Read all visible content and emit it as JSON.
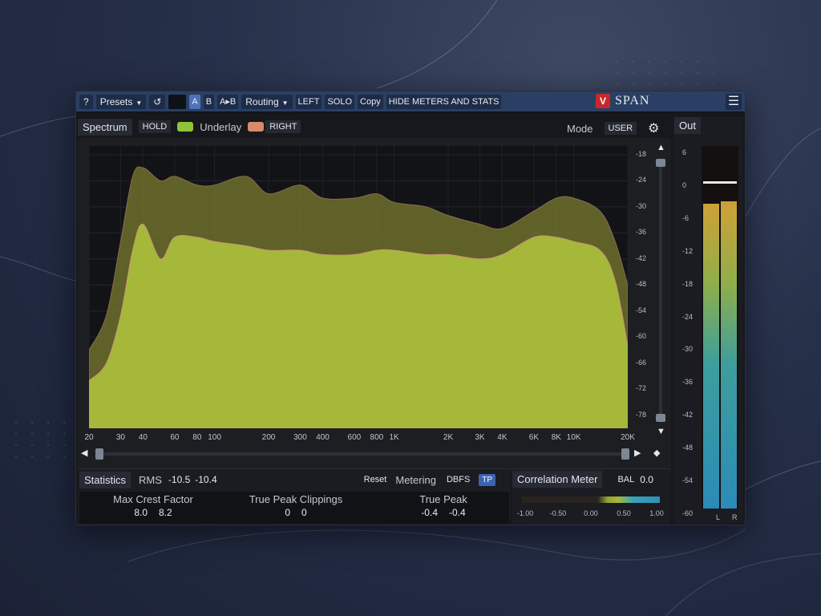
{
  "toolbar": {
    "help": "?",
    "presets": "Presets",
    "undo": "↺",
    "a": "A",
    "b": "B",
    "a_to_b": "A▸B",
    "routing": "Routing",
    "left": "LEFT",
    "solo": "SOLO",
    "copy": "Copy",
    "hide_meters": "HIDE METERS AND STATS",
    "logo_badge": "V",
    "logo_text": "SPAN",
    "menu": "☰"
  },
  "spectrum": {
    "tab": "Spectrum",
    "hold": "HOLD",
    "underlay": "Underlay",
    "right": "RIGHT",
    "mode_label": "Mode",
    "mode_value": "USER",
    "gear": "⚙",
    "hold_color": "#8dc43a",
    "right_color": "#d98a6a",
    "fill_color": "#a6b83a",
    "underlay_color": "#7c7b2e",
    "db_ticks": [
      "-18",
      "-24",
      "-30",
      "-36",
      "-42",
      "-48",
      "-54",
      "-60",
      "-66",
      "-72",
      "-78"
    ],
    "freq_ticks": [
      {
        "label": "20",
        "hz": 20
      },
      {
        "label": "30",
        "hz": 30
      },
      {
        "label": "40",
        "hz": 40
      },
      {
        "label": "60",
        "hz": 60
      },
      {
        "label": "80",
        "hz": 80
      },
      {
        "label": "100",
        "hz": 100
      },
      {
        "label": "200",
        "hz": 200
      },
      {
        "label": "300",
        "hz": 300
      },
      {
        "label": "400",
        "hz": 400
      },
      {
        "label": "600",
        "hz": 600
      },
      {
        "label": "800",
        "hz": 800
      },
      {
        "label": "1K",
        "hz": 1000
      },
      {
        "label": "2K",
        "hz": 2000
      },
      {
        "label": "3K",
        "hz": 3000
      },
      {
        "label": "4K",
        "hz": 4000
      },
      {
        "label": "6K",
        "hz": 6000
      },
      {
        "label": "8K",
        "hz": 8000
      },
      {
        "label": "10K",
        "hz": 10000
      },
      {
        "label": "20K",
        "hz": 20000
      }
    ]
  },
  "chart_data": {
    "type": "area",
    "xlabel": "",
    "ylabel": "",
    "xscale": "log",
    "ylim": [
      -81,
      -16
    ],
    "series": [
      {
        "name": "Underlay",
        "x": [
          20,
          25,
          30,
          35,
          40,
          50,
          60,
          80,
          100,
          150,
          200,
          300,
          400,
          600,
          800,
          1000,
          1500,
          2000,
          3000,
          4000,
          6000,
          8000,
          10000,
          14000,
          17000,
          20000
        ],
        "values": [
          -63,
          -55,
          -38,
          -23,
          -21,
          -24,
          -23,
          -25,
          -25,
          -23,
          -27,
          -25,
          -28,
          -28,
          -27,
          -29,
          -30,
          -32,
          -34,
          -35,
          -31,
          -28,
          -28,
          -31,
          -38,
          -48
        ]
      },
      {
        "name": "HOLD",
        "x": [
          20,
          25,
          30,
          35,
          40,
          50,
          60,
          80,
          100,
          150,
          200,
          300,
          400,
          600,
          800,
          1000,
          1500,
          2000,
          3000,
          4000,
          6000,
          8000,
          10000,
          14000,
          17000,
          20000
        ],
        "values": [
          -70,
          -66,
          -55,
          -40,
          -34,
          -42,
          -37,
          -37,
          -38,
          -39,
          -40,
          -40,
          -41,
          -41,
          -40,
          -40,
          -41,
          -41,
          -42,
          -41,
          -37,
          -37,
          -38,
          -40,
          -47,
          -62
        ]
      }
    ]
  },
  "statistics": {
    "tab": "Statistics",
    "rms_label": "RMS",
    "rms_l": "-10.5",
    "rms_r": "-10.4",
    "reset": "Reset",
    "metering": "Metering",
    "dbfs": "DBFS",
    "tp": "TP",
    "crest_title": "Max Crest Factor",
    "crest_l": "8.0",
    "crest_r": "8.2",
    "clip_title": "True Peak Clippings",
    "clip_l": "0",
    "clip_r": "0",
    "peak_title": "True Peak",
    "peak_l": "-0.4",
    "peak_r": "-0.4"
  },
  "correlation": {
    "tab": "Correlation Meter",
    "bal": "BAL",
    "bal_value": "0.0",
    "ticks": [
      "-1.00",
      "-0.50",
      "0.00",
      "0.50",
      "1.00"
    ]
  },
  "out_meter": {
    "tab": "Out",
    "ticks": [
      "6",
      "0",
      "-6",
      "-12",
      "-18",
      "-24",
      "-30",
      "-36",
      "-42",
      "-48",
      "-54",
      "-60"
    ],
    "left_level_db": -4.5,
    "right_level_db": -4.0,
    "peak_db": -0.4,
    "l": "L",
    "r": "R"
  }
}
